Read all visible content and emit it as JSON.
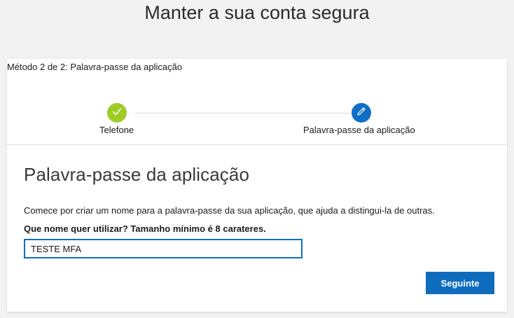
{
  "header": {
    "title": "Manter a sua conta segura"
  },
  "wizard": {
    "method_label": "Método 2 de 2: Palavra-passe da aplicação",
    "steps": [
      {
        "label": "Telefone",
        "status": "done",
        "icon": "check-icon"
      },
      {
        "label": "Palavra-passe da aplicação",
        "status": "active",
        "icon": "pencil-icon"
      }
    ]
  },
  "form": {
    "title": "Palavra-passe da aplicação",
    "instructions": "Comece por criar um nome para a palavra-passe da sua aplicação, que ajuda a distingui-la de outras.",
    "field_label": "Que nome quer utilizar? Tamanho mínimo é 8 carateres.",
    "name_value": "TESTE MFA",
    "next_label": "Seguinte"
  },
  "colors": {
    "accent": "#0f6cbd",
    "done": "#9fcb27",
    "background": "#f2f2f2"
  }
}
